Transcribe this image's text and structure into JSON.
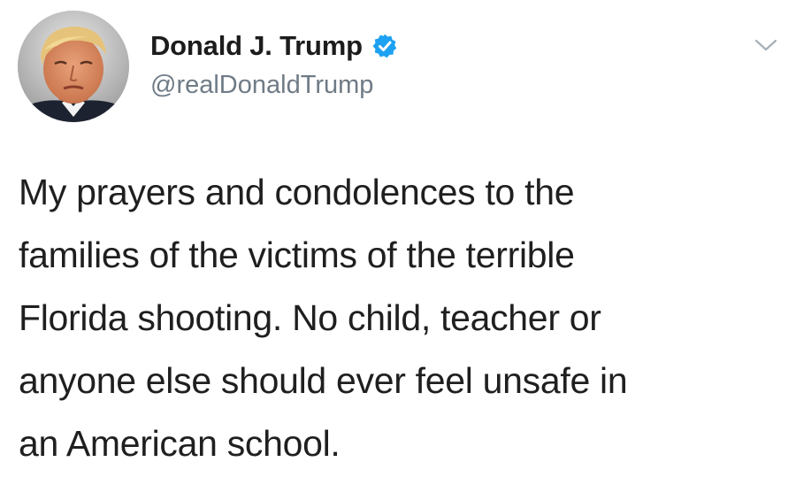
{
  "tweet": {
    "author": {
      "display_name": "Donald J. Trump",
      "handle": "@realDonaldTrump",
      "verified": true,
      "verified_icon": "verified-badge-icon",
      "avatar_icon": "profile-photo",
      "verified_color": "#1da1f2"
    },
    "menu_icon": "chevron-down-icon",
    "text_lines": [
      "My prayers and condolences to the",
      "families of the victims of the terrible",
      "Florida shooting. No child, teacher or",
      "anyone else should ever feel unsafe in",
      "an American school."
    ],
    "colors": {
      "background": "#ffffff",
      "text": "#1f1f1f",
      "handle": "#6f7b86"
    }
  }
}
